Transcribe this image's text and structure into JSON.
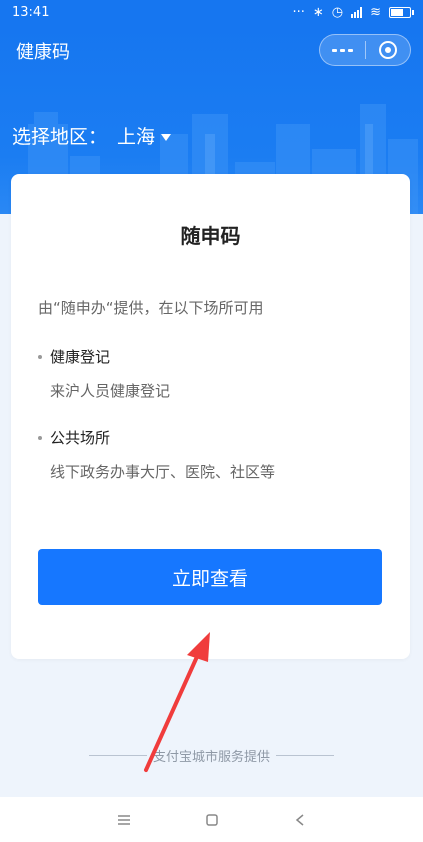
{
  "status_bar": {
    "time": "13:41"
  },
  "header": {
    "title": "健康码",
    "capsule_more_icon": "more-dots-icon",
    "capsule_close_icon": "close-target-icon",
    "region_label": "选择地区：",
    "region_value": "上海"
  },
  "card": {
    "title": "随申码",
    "description": "由“随申办“提供，在以下场所可用",
    "items": [
      {
        "title": "健康登记",
        "subtitle": "来沪人员健康登记"
      },
      {
        "title": "公共场所",
        "subtitle": "线下政务办事大厅、医院、社区等"
      }
    ],
    "button_label": "立即查看"
  },
  "footer": {
    "text": "支付宝城市服务提供"
  },
  "colors": {
    "primary": "#1677ff",
    "header": "#1676f0",
    "annotation_arrow": "#f03c3c"
  }
}
